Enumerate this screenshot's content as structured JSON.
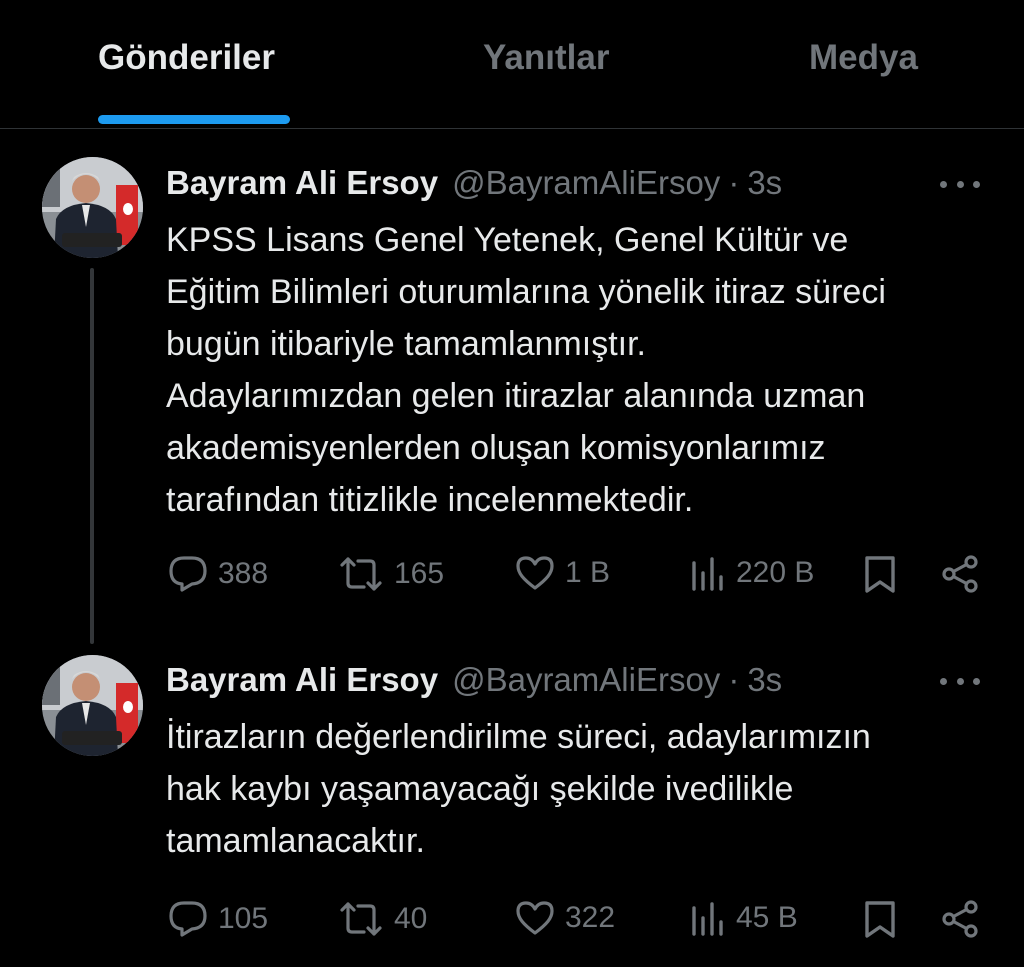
{
  "tabs": [
    {
      "label": "Gönderiler",
      "active": true
    },
    {
      "label": "Yanıtlar",
      "active": false
    },
    {
      "label": "Medya",
      "active": false
    }
  ],
  "colors": {
    "background": "#000000",
    "text": "#e7e9ea",
    "muted": "#71767b",
    "accent": "#1d9bf0",
    "divider": "#2f3336"
  },
  "tweets": [
    {
      "author": "Bayram Ali Ersoy",
      "handle": "@BayramAliErsoy",
      "separator": "·",
      "time": "3s",
      "lines": [
        "KPSS Lisans Genel Yetenek, Genel Kültür ve",
        "Eğitim Bilimleri oturumlarına yönelik itiraz süreci",
        "bugün itibariyle tamamlanmıştır.",
        "Adaylarımızdan gelen itirazlar alanında uzman",
        "akademisyenlerden oluşan komisyonlarımız",
        "tarafından titizlikle incelenmektedir."
      ],
      "replies": "388",
      "reposts": "165",
      "likes": "1 B",
      "views": "220 B"
    },
    {
      "author": "Bayram Ali Ersoy",
      "handle": "@BayramAliErsoy",
      "separator": "·",
      "time": "3s",
      "lines": [
        "İtirazların değerlendirilme süreci, adaylarımızın",
        "hak kaybı yaşamayacağı şekilde ivedilikle",
        "tamamlanacaktır."
      ],
      "replies": "105",
      "reposts": "40",
      "likes": "322",
      "views": "45 B"
    }
  ],
  "icons": {
    "reply": "reply-icon",
    "repost": "repost-icon",
    "like": "heart-icon",
    "views": "views-icon",
    "bookmark": "bookmark-icon",
    "share": "share-icon",
    "more": "more-icon"
  }
}
